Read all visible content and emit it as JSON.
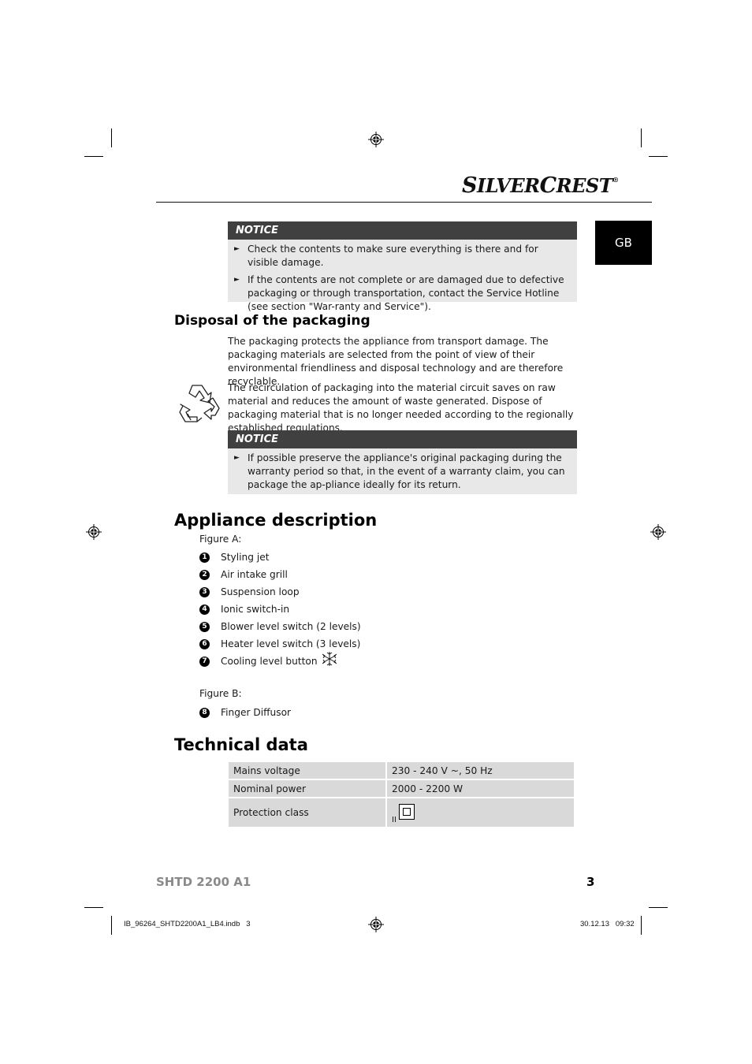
{
  "header": {
    "brand_main": "S",
    "brand_rest1": "ILVER",
    "brand_c": "C",
    "brand_rest2": "REST",
    "brand_registered": "®",
    "language_tab": "GB"
  },
  "notice1": {
    "title": "NOTICE",
    "items": [
      "Check the contents to make sure everything is there and for visible damage.",
      "If the contents are not complete or are damaged due to defective packaging or through transportation, contact the Service Hotline (see section \"War-ranty and Service\")."
    ]
  },
  "disposal": {
    "heading": "Disposal of the packaging",
    "para1": "The packaging protects the appliance from transport damage. The packaging materials are selected from the point of view of their environmental friendliness and disposal technology and are therefore recyclable.",
    "para2": " The recirculation of packaging into the material circuit saves on raw material and reduces the amount of waste generated. Dispose of packaging material that is no longer needed according to the regionally established regulations.",
    "icon": "recycle-icon"
  },
  "notice2": {
    "title": "NOTICE",
    "items": [
      "If possible preserve the appliance's original packaging during the warranty period so that, in the event of a warranty claim, you can package the ap-pliance ideally for its return."
    ]
  },
  "appliance": {
    "heading": "Appliance description",
    "figure_a_label": "Figure A:",
    "figure_a_items": [
      {
        "num": "1",
        "label": "Styling jet"
      },
      {
        "num": "2",
        "label": "Air intake grill"
      },
      {
        "num": "3",
        "label": "Suspension loop"
      },
      {
        "num": "4",
        "label": "Ionic switch-in"
      },
      {
        "num": "5",
        "label": "Blower level switch (2 levels)"
      },
      {
        "num": "6",
        "label": "Heater level switch (3 levels)"
      },
      {
        "num": "7",
        "label": "Cooling level button",
        "icon": "snowflake-icon"
      }
    ],
    "figure_b_label": "Figure B:",
    "figure_b_items": [
      {
        "num": "8",
        "label": "Finger Diffusor"
      }
    ]
  },
  "technical": {
    "heading": "Technical data",
    "rows": [
      {
        "key": "Mains voltage",
        "value": "230 - 240 V ~, 50 Hz"
      },
      {
        "key": "Nominal power",
        "value": "2000 - 2200 W"
      },
      {
        "key": "Protection class",
        "value": "II",
        "icon": "protection-class-ii-icon"
      }
    ]
  },
  "footer": {
    "model": "SHTD 2200 A1",
    "page_number": "3",
    "slug_file": "IB_96264_SHTD2200A1_LB4.indb   3",
    "slug_date": "30.12.13   09:32"
  }
}
